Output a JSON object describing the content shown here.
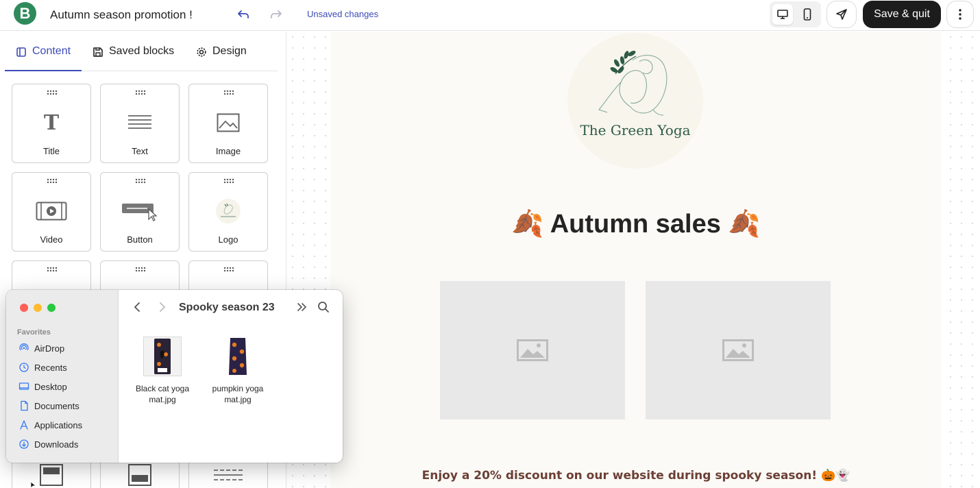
{
  "topbar": {
    "logo_letter": "B",
    "document_title": "Autumn season promotion !",
    "status": "Unsaved changes",
    "save_label": "Save & quit"
  },
  "left_panel": {
    "tabs": [
      {
        "label": "Content",
        "icon": "layout-icon",
        "active": true
      },
      {
        "label": "Saved blocks",
        "icon": "save-disk-icon",
        "active": false
      },
      {
        "label": "Design",
        "icon": "gear-icon",
        "active": false
      }
    ],
    "blocks": [
      {
        "label": "Title",
        "icon": "title-T-icon"
      },
      {
        "label": "Text",
        "icon": "text-lines-icon"
      },
      {
        "label": "Image",
        "icon": "image-icon"
      },
      {
        "label": "Video",
        "icon": "video-icon"
      },
      {
        "label": "Button",
        "icon": "button-cursor-icon"
      },
      {
        "label": "Logo",
        "icon": "logo-thumbnail-icon"
      }
    ]
  },
  "email": {
    "brand_name": "The Green Yoga",
    "headline": "🍂 Autumn sales 🍂",
    "promo_text": "Enjoy a 20% discount on our website during spooky season! 🎃👻"
  },
  "finder": {
    "folder_title": "Spooky season 23",
    "favorites_heading": "Favorites",
    "favorites": [
      {
        "label": "AirDrop",
        "icon": "airdrop-icon"
      },
      {
        "label": "Recents",
        "icon": "clock-icon"
      },
      {
        "label": "Desktop",
        "icon": "desktop-icon"
      },
      {
        "label": "Documents",
        "icon": "document-icon"
      },
      {
        "label": "Applications",
        "icon": "applications-icon"
      },
      {
        "label": "Downloads",
        "icon": "download-icon"
      }
    ],
    "files": [
      {
        "name_line1": "Black cat yoga",
        "name_line2": "mat.jpg"
      },
      {
        "name_line1": "pumpkin yoga",
        "name_line2": "mat.jpg"
      }
    ]
  },
  "colors": {
    "accent": "#3b4ab8",
    "brand_green": "#2f8a5b",
    "save_button": "#1c1c1c",
    "promo_text": "#6b3f35"
  }
}
